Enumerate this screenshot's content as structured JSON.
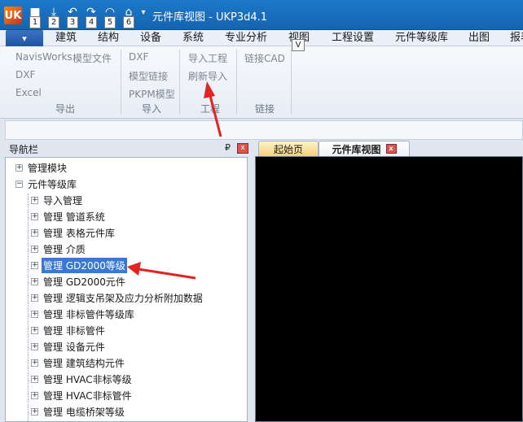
{
  "app": {
    "title": "元件库视图 - UKP3d4.1",
    "icon_glyph": "UK"
  },
  "quick_access": [
    {
      "icon": "save-icon",
      "glyph": "■",
      "keytip": "1"
    },
    {
      "icon": "download-icon",
      "glyph": "⤓",
      "keytip": "2"
    },
    {
      "icon": "undo-icon",
      "glyph": "↶",
      "keytip": "3"
    },
    {
      "icon": "redo-icon",
      "glyph": "↷",
      "keytip": "4"
    },
    {
      "icon": "wireless-icon",
      "glyph": "◠",
      "keytip": "5"
    },
    {
      "icon": "toolbox-icon",
      "glyph": "⌂",
      "keytip": "6"
    }
  ],
  "qat_dropdown_glyph": "▾",
  "menu": {
    "file_glyph": "▾",
    "tabs": [
      "建筑",
      "结构",
      "设备",
      "系统",
      "专业分析",
      "视图",
      "工程设置",
      "元件等级库",
      "出图",
      "报表"
    ],
    "view_keytip": "V"
  },
  "ribbon": {
    "groups": [
      {
        "label": "导出",
        "items": [
          "NavisWorks",
          "模型文件",
          "DXF",
          "Excel"
        ]
      },
      {
        "label": "导入",
        "items": [
          "DXF",
          "模型链接",
          "PKPM模型"
        ]
      },
      {
        "label": "工程",
        "items": [
          "导入工程",
          "刷新导入"
        ]
      },
      {
        "label": "链接",
        "items": [
          "链接CAD"
        ]
      }
    ]
  },
  "nav": {
    "title": "导航栏",
    "pin_glyph": "₽",
    "close_glyph": "x",
    "tree": [
      {
        "label": "管理模块",
        "sign": "+",
        "level": 0
      },
      {
        "label": "元件等级库",
        "sign": "−",
        "level": 0
      },
      {
        "label": "导入管理",
        "sign": "+",
        "level": 1
      },
      {
        "label": "管理 管道系统",
        "sign": "+",
        "level": 1
      },
      {
        "label": "管理 表格元件库",
        "sign": "+",
        "level": 1
      },
      {
        "label": "管理 介质",
        "sign": "+",
        "level": 1
      },
      {
        "label": "管理 GD2000等级",
        "sign": "+",
        "level": 1,
        "selected": true
      },
      {
        "label": "管理 GD2000元件",
        "sign": "+",
        "level": 1
      },
      {
        "label": "管理 逻辑支吊架及应力分析附加数据",
        "sign": "+",
        "level": 1
      },
      {
        "label": "管理 非标管件等级库",
        "sign": "+",
        "level": 1
      },
      {
        "label": "管理 非标管件",
        "sign": "+",
        "level": 1
      },
      {
        "label": "管理 设备元件",
        "sign": "+",
        "level": 1
      },
      {
        "label": "管理 建筑结构元件",
        "sign": "+",
        "level": 1
      },
      {
        "label": "管理 HVAC非标等级",
        "sign": "+",
        "level": 1
      },
      {
        "label": "管理 HVAC非标管件",
        "sign": "+",
        "level": 1
      },
      {
        "label": "管理 电缆桥架等级",
        "sign": "+",
        "level": 1
      }
    ]
  },
  "documents": {
    "tabs": [
      "起始页",
      "元件库视图"
    ],
    "active_close_glyph": "x"
  },
  "colors": {
    "annotation": "#e32222",
    "selection": "#3a78d6",
    "titlebar": "#1d79c9"
  }
}
